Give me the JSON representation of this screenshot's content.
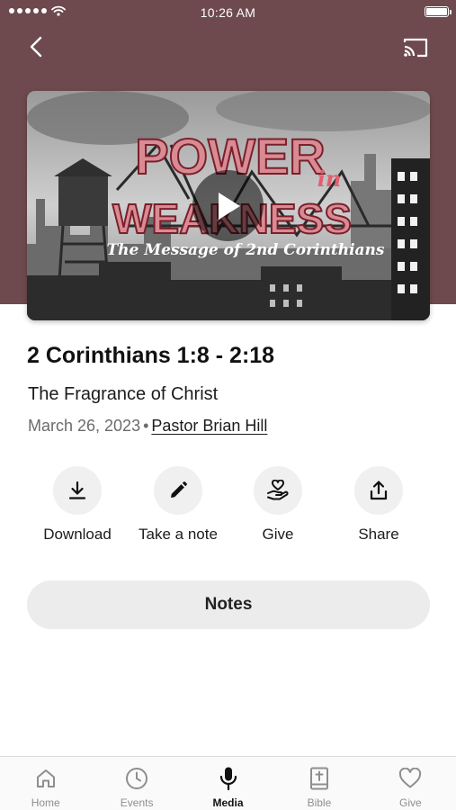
{
  "status_bar": {
    "time": "10:26 AM"
  },
  "header": {
    "back_icon": "chevron-left-icon",
    "cast_icon": "cast-icon",
    "background_color": "#6e4a4e"
  },
  "video": {
    "thumbnail_title_line1": "POWER",
    "thumbnail_title_in": "in",
    "thumbnail_title_line2": "WEAKNESS",
    "thumbnail_subtitle": "The Message of 2nd Corinthians",
    "play_icon": "play-icon"
  },
  "sermon": {
    "title": "2 Corinthians 1:8 - 2:18",
    "subtitle": "The Fragrance of Christ",
    "date": "March 26, 2023",
    "separator": "•",
    "speaker": "Pastor Brian Hill"
  },
  "actions": [
    {
      "label": "Download",
      "icon": "download-icon"
    },
    {
      "label": "Take a note",
      "icon": "pencil-icon"
    },
    {
      "label": "Give",
      "icon": "give-hand-heart-icon"
    },
    {
      "label": "Share",
      "icon": "share-icon"
    }
  ],
  "notes_button": {
    "label": "Notes"
  },
  "tab_bar": {
    "items": [
      {
        "label": "Home",
        "icon": "home-icon",
        "active": false
      },
      {
        "label": "Events",
        "icon": "clock-icon",
        "active": false
      },
      {
        "label": "Media",
        "icon": "microphone-icon",
        "active": true
      },
      {
        "label": "Bible",
        "icon": "bible-icon",
        "active": false
      },
      {
        "label": "Give",
        "icon": "heart-icon",
        "active": false
      }
    ],
    "active_color": "#111111",
    "inactive_color": "#8e8e8e"
  }
}
